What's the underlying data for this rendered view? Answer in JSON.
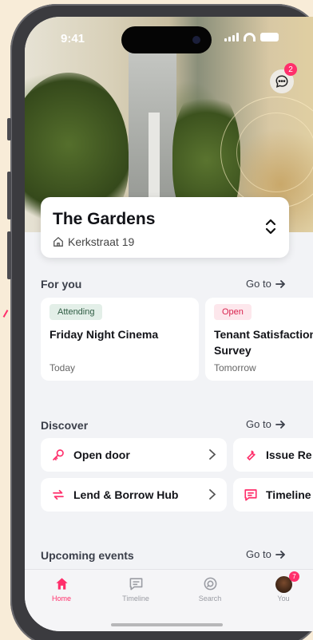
{
  "status_bar": {
    "time": "9:41"
  },
  "header": {
    "chat_badge": "2"
  },
  "building": {
    "name": "The Gardens",
    "address": "Kerkstraat 19"
  },
  "for_you": {
    "title": "For you",
    "goto": "Go to",
    "cards": [
      {
        "tag": "Attending",
        "title": "Friday Night Cinema",
        "date": "Today"
      },
      {
        "tag": "Open",
        "title": "Tenant Satisfaction Survey",
        "date": "Tomorrow"
      }
    ]
  },
  "discover": {
    "title": "Discover",
    "goto": "Go to",
    "items": [
      {
        "label": "Open door",
        "icon": "key-icon"
      },
      {
        "label": "Issue Re",
        "icon": "wrench-icon"
      },
      {
        "label": "Lend & Borrow Hub",
        "icon": "swap-icon"
      },
      {
        "label": "Timeline",
        "icon": "message-icon"
      }
    ]
  },
  "upcoming": {
    "title": "Upcoming events",
    "goto": "Go to"
  },
  "nav": {
    "items": [
      {
        "label": "Home",
        "icon": "home-icon",
        "active": true
      },
      {
        "label": "Timeline",
        "icon": "timeline-icon"
      },
      {
        "label": "Search",
        "icon": "search-icon"
      },
      {
        "label": "You",
        "icon": "avatar"
      }
    ],
    "you_badge": "7"
  },
  "colors": {
    "accent": "#ff2f6b",
    "attending_bg": "#e3efe8",
    "attending_fg": "#2f5c43",
    "open_bg": "#fde7ec",
    "open_fg": "#d9244f"
  }
}
